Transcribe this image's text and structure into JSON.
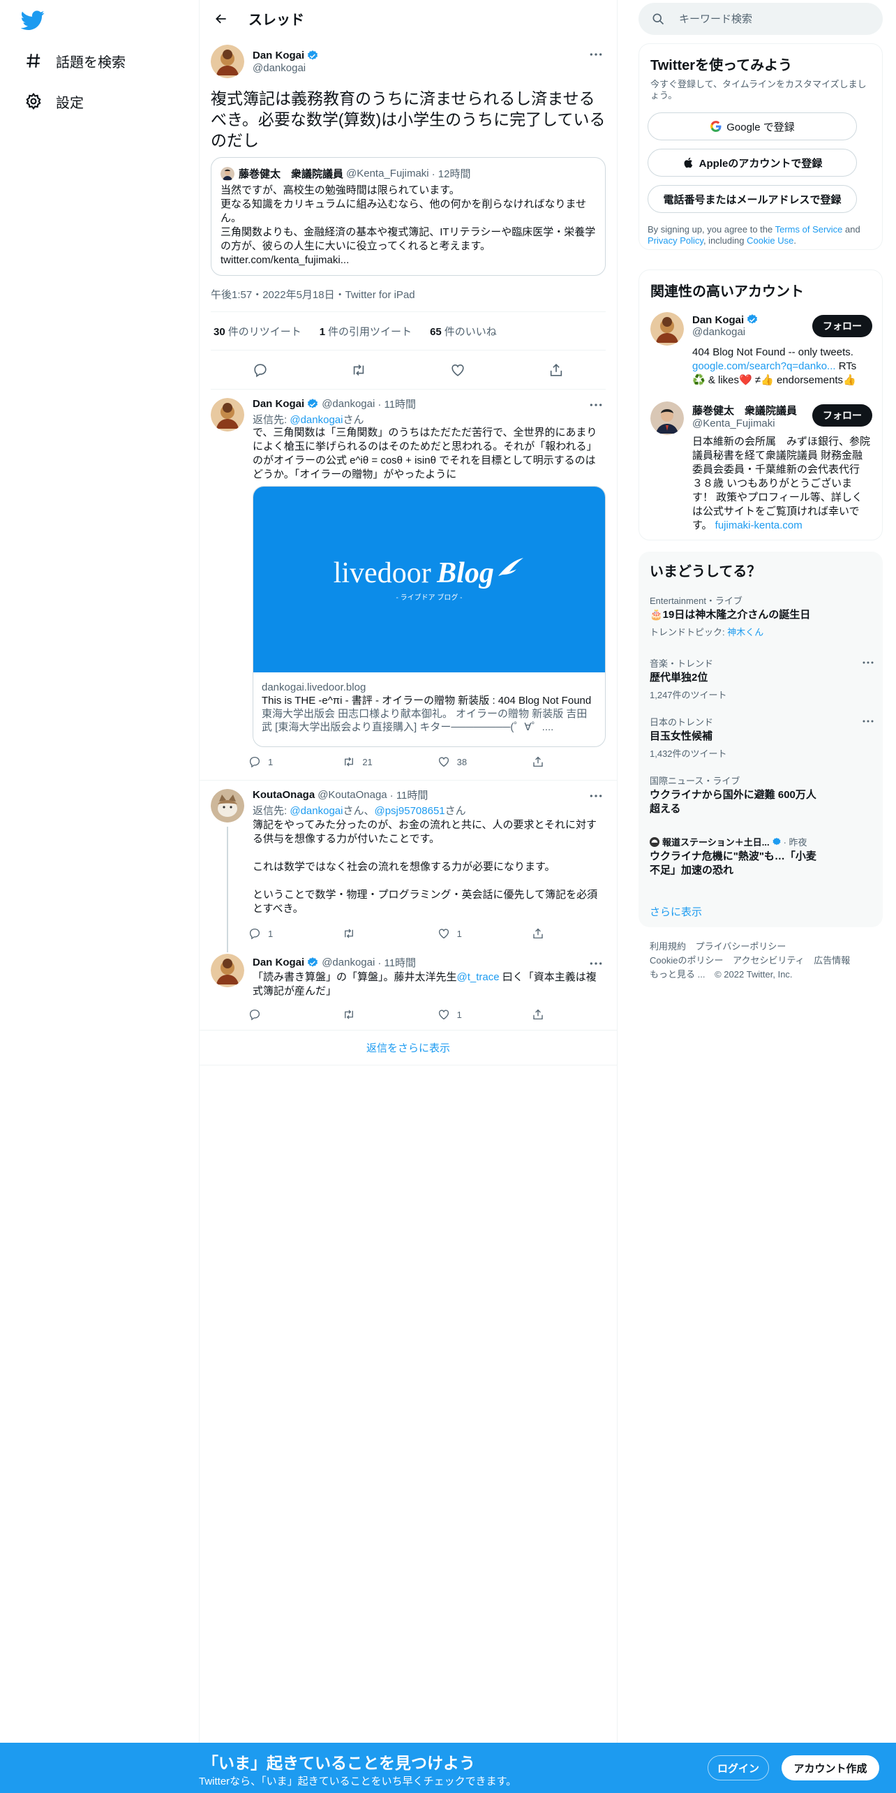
{
  "nav": {
    "logo": "twitter-bird-icon",
    "items": [
      {
        "label": "話題を検索",
        "icon": "hashtag-icon"
      },
      {
        "label": "設定",
        "icon": "gear-icon"
      }
    ]
  },
  "thread": {
    "title": "スレッド",
    "main_tweet": {
      "name": "Dan Kogai",
      "handle": "@dankogai",
      "text": "複式簿記は義務教育のうちに済ませられるし済ませるべき。必要な数学(算数)は小学生のうちに完了しているのだし",
      "quote": {
        "name": "藤巻健太　衆議院議員",
        "handle": "@Kenta_Fujimaki",
        "time": "· 12時間",
        "lines": [
          "当然ですが、高校生の勉強時間は限られています。",
          "更なる知識をカリキュラムに組み込むなら、他の何かを削らなければなりません。",
          "三角関数よりも、金融経済の基本や複式簿記、ITリテラシーや臨床医学・栄養学の方が、彼らの人生に大いに役立ってくれると考えます。",
          "twitter.com/kenta_fujimaki..."
        ]
      },
      "meta": "午後1:57・2022年5月18日・Twitter for iPad",
      "stats": {
        "retweets": "30",
        "retweets_label": "件のリツイート",
        "quotes": "1",
        "quotes_label": "件の引用ツイート",
        "likes": "65",
        "likes_label": "件のいいね"
      }
    },
    "replies": [
      {
        "name": "Dan Kogai",
        "handle": "@dankogai",
        "time": "· 11時間",
        "replying_prefix": "返信先: ",
        "replying_to": "@dankogai",
        "replying_suffix": "さん",
        "text": "で、三角関数は「三角関数」のうちはただただ苦行で、全世界的にあまりによく槍玉に挙げられるのはそのためだと思われる。それが「報われる」のがオイラーの公式 e^iθ = cosθ + isinθ でそれを目標として明示するのはどうか。「オイラーの贈物」がやったように",
        "card": {
          "image_logo": "livedoor",
          "image_logo_script": "Blog",
          "image_caption": "- ライブドア ブログ -",
          "domain": "dankogai.livedoor.blog",
          "title": "This is THE -e^πi - 書評 - オイラーの贈物 新装版 : 404 Blog Not Found",
          "desc": "東海大学出版会 田志口様より献本御礼。 オイラーの贈物 新装版 吉田武 [東海大学出版会より直接購入] キター────────(゜∀゜...."
        },
        "actions": {
          "reply": "1",
          "retweet": "21",
          "like": "38"
        }
      },
      {
        "name": "KoutaOnaga",
        "handle": "@KoutaOnaga",
        "time": "· 11時間",
        "replying_prefix": "返信先: ",
        "replying_to": "@dankogai",
        "replying_mid": "さん、",
        "replying_to2": "@psj95708651",
        "replying_suffix": "さん",
        "text": "簿記をやってみた分ったのが、お金の流れと共に、人の要求とそれに対する供与を想像する力が付いたことです。\n\nこれは数学ではなく社会の流れを想像する力が必要になります。\n\nということで数学・物理・プログラミング・英会話に優先して簿記を必須とすべき。",
        "actions": {
          "reply": "1",
          "retweet": "",
          "like": "1"
        }
      },
      {
        "name": "Dan Kogai",
        "handle": "@dankogai",
        "time": "· 11時間",
        "text_before": "「読み書き算盤」の「算盤」。藤井太洋先生",
        "mention": "@t_trace",
        "text_after": " 曰く「資本主義は複式簿記が産んだ」",
        "actions": {
          "reply": "",
          "retweet": "",
          "like": "1"
        }
      }
    ],
    "show_more": "返信をさらに表示"
  },
  "sidebar": {
    "search_placeholder": "キーワード検索",
    "signup": {
      "title": "Twitterを使ってみよう",
      "sub": "今すぐ登録して、タイムラインをカスタマイズしましょう。",
      "google": "Google で登録",
      "apple": "Appleのアカウントで登録",
      "phone": "電話番号またはメールアドレスで登録",
      "terms_1": "By signing up, you agree to the ",
      "terms_link1": "Terms of Service",
      "terms_2": " and ",
      "terms_link2": "Privacy Policy",
      "terms_3": ", including ",
      "terms_link3": "Cookie Use",
      "terms_4": "."
    },
    "accounts": {
      "title": "関連性の高いアカウント",
      "items": [
        {
          "name": "Dan Kogai",
          "handle": "@dankogai",
          "follow": "フォロー",
          "bio_1": "404 Blog Not Found -- only tweets. ",
          "bio_link": "google.com/search?q=danko...",
          "bio_2": " RTs ♻️ & likes❤️ ≠👍 endorsements👍"
        },
        {
          "name": "藤巻健太　衆議院議員",
          "handle": "@Kenta_Fujimaki",
          "follow": "フォロー",
          "bio_1": "日本維新の会所属　みずほ銀行、参院議員秘書を経て衆議院議員 財務金融委員会委員・千葉維新の会代表代行 ３８歳 いつもありがとうございます！ 政策やプロフィール等、詳しくは公式サイトをご覧頂ければ幸いです。 ",
          "bio_link": "fujimaki-kenta.com",
          "bio_2": ""
        }
      ]
    },
    "trends": {
      "title": "いまどうしてる？",
      "items": [
        {
          "context": "Entertainment・ライブ",
          "name": "🎂19日は神木隆之介さんの誕生日",
          "sub_prefix": "トレンドトピック: ",
          "sub_link": "神木くん",
          "more": false
        },
        {
          "context": "音楽・トレンド",
          "name": "歴代単独2位",
          "sub": "1,247件のツイート",
          "more": true
        },
        {
          "context": "日本のトレンド",
          "name": "目玉女性候補",
          "sub": "1,432件のツイート",
          "more": true
        },
        {
          "context": "国際ニュース・ライブ",
          "name": "ウクライナから国外に避難 600万人超える",
          "sub": "",
          "more": false
        },
        {
          "context_name": "報道ステーション＋土日...",
          "context_time": "· 昨夜",
          "name": "ウクライナ危機に\"熱波\"も…「小麦不足」加速の恐れ",
          "sub": "",
          "more": false
        }
      ],
      "show_more": "さらに表示"
    },
    "footer": [
      "利用規約",
      "プライバシーポリシー",
      "Cookieのポリシー",
      "アクセシビリティ",
      "広告情報",
      "もっと見る ...",
      "© 2022 Twitter, Inc."
    ]
  },
  "bottom_bar": {
    "title": "「いま」起きていることを見つけよう",
    "sub": "Twitterなら、「いま」起きていることをいち早くチェックできます。",
    "login": "ログイン",
    "signup": "アカウント作成"
  },
  "colors": {
    "accent": "#1d9bf0",
    "text": "#0f1419",
    "muted": "#536471",
    "like": "#f91880"
  }
}
